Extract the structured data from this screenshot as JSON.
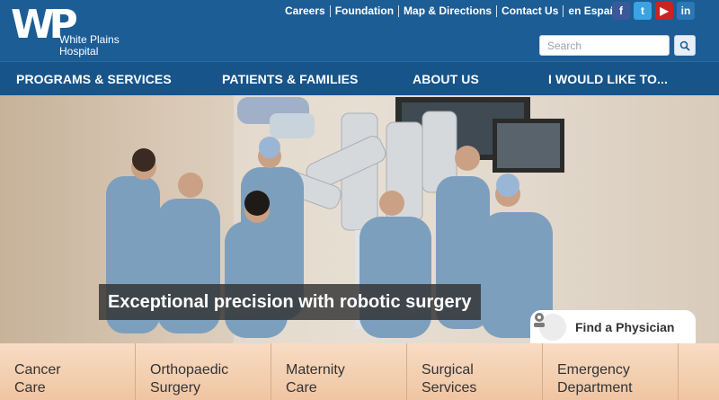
{
  "logo": {
    "mark": "WP",
    "name_line1": "White Plains",
    "name_line2": "Hospital"
  },
  "top_links": [
    "Careers",
    "Foundation",
    "Map & Directions",
    "Contact Us",
    "en Español"
  ],
  "social": [
    {
      "name": "facebook-icon",
      "glyph": "f",
      "color": "#3b5998"
    },
    {
      "name": "twitter-icon",
      "glyph": "t",
      "color": "#3aa3e3"
    },
    {
      "name": "youtube-icon",
      "glyph": "▶",
      "color": "#cc2222"
    },
    {
      "name": "linkedin-icon",
      "glyph": "in",
      "color": "#2b78b5"
    }
  ],
  "search": {
    "placeholder": "Search",
    "value": ""
  },
  "nav": [
    "PROGRAMS & SERVICES",
    "PATIENTS & FAMILIES",
    "ABOUT US",
    "I WOULD LIKE TO..."
  ],
  "hero": {
    "caption": "Exceptional precision with robotic surgery",
    "find_physician": "Find a Physician"
  },
  "tiles": [
    {
      "line1": "Cancer",
      "line2": "Care"
    },
    {
      "line1": "Orthopaedic",
      "line2": "Surgery"
    },
    {
      "line1": "Maternity",
      "line2": "Care"
    },
    {
      "line1": "Surgical",
      "line2": "Services"
    },
    {
      "line1": "Emergency",
      "line2": "Department"
    },
    {
      "line1": "",
      "line2": ""
    }
  ],
  "colors": {
    "header": "#1c5d96",
    "nav": "#17548a",
    "tile": "#f2ceb0",
    "text": "#333333"
  }
}
